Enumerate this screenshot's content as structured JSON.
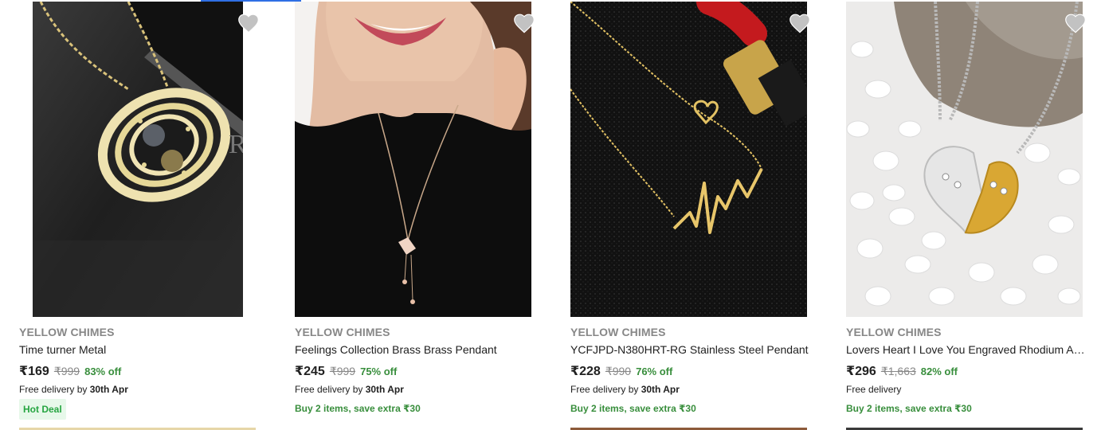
{
  "products": [
    {
      "brand": "YELLOW CHIMES",
      "title": "Time turner Metal",
      "price": "₹169",
      "mrp": "₹999",
      "discount": "83% off",
      "delivery_prefix": "Free delivery by ",
      "delivery_date": "30th Apr",
      "badge": "Hot Deal",
      "image_icon": "necklace-pendant-image"
    },
    {
      "brand": "YELLOW CHIMES",
      "title": "Feelings Collection Brass Brass Pendant",
      "price": "₹245",
      "mrp": "₹999",
      "discount": "75% off",
      "delivery_prefix": "Free delivery by ",
      "delivery_date": "30th Apr",
      "offer": "Buy 2 items, save extra ₹30",
      "image_icon": "necklace-model-image"
    },
    {
      "brand": "YELLOW CHIMES",
      "title": "YCFJPD-N380HRT-RG Stainless Steel Pendant",
      "price": "₹228",
      "mrp": "₹990",
      "discount": "76% off",
      "delivery_prefix": "Free delivery by ",
      "delivery_date": "30th Apr",
      "offer": "Buy 2 items, save extra ₹30",
      "image_icon": "heartbeat-necklace-image"
    },
    {
      "brand": "YELLOW CHIMES",
      "title": "Lovers Heart I Love You Engraved Rhodium Alloy Pendant",
      "price": "₹296",
      "mrp": "₹1,663",
      "discount": "82% off",
      "delivery_prefix": "Free delivery",
      "delivery_date": "",
      "offer": "Buy 2 items, save extra ₹30",
      "image_icon": "heart-pendant-image"
    }
  ],
  "colors": {
    "brand_gray": "#878787",
    "discount_green": "#388e3c",
    "hot_deal_bg": "#e7f8ea",
    "wishlist_gray": "#c2c2c2",
    "accent_blue": "#2f6fe4"
  }
}
